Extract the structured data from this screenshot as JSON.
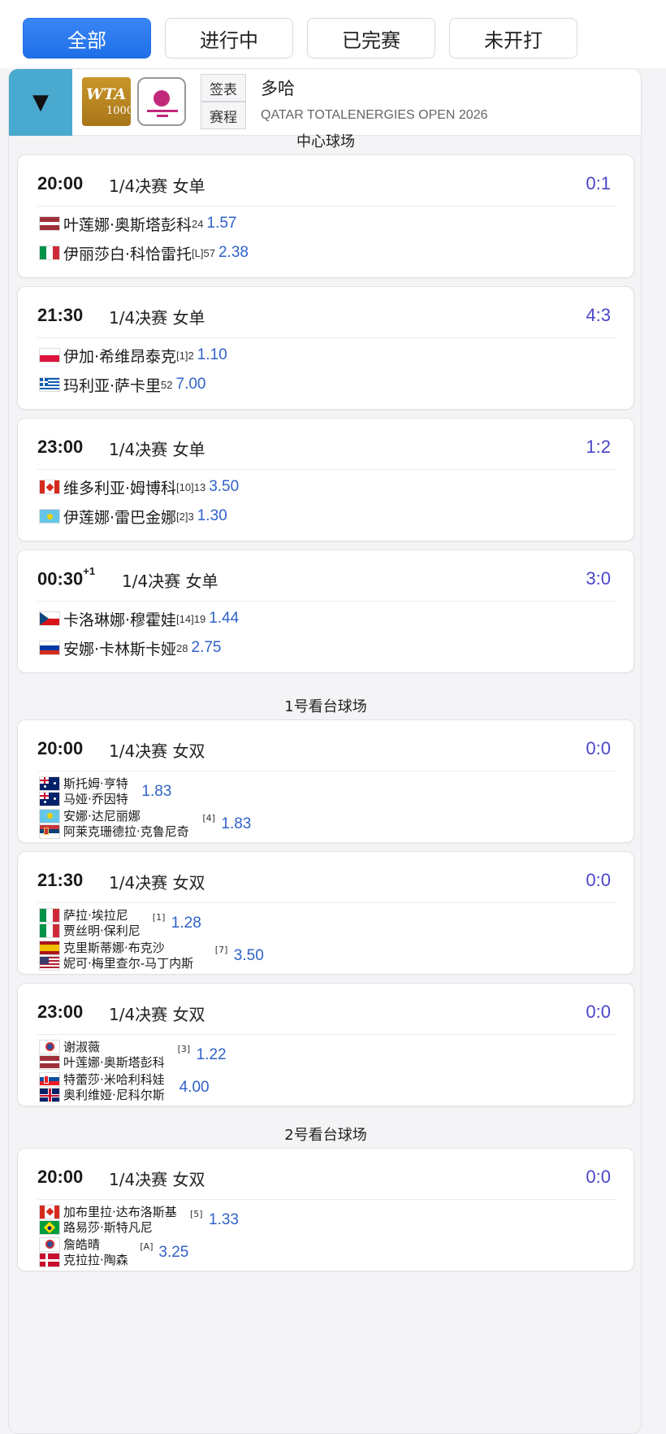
{
  "tabs": [
    {
      "label": "全部",
      "active": true
    },
    {
      "label": "进行中",
      "active": false
    },
    {
      "label": "已完赛",
      "active": false
    },
    {
      "label": "未开打",
      "active": false
    }
  ],
  "header": {
    "toggle_icon": "▼",
    "logo_wta_text": "WTA",
    "logo_wta_sub": "1000",
    "btn_draw": "签表",
    "btn_schedule": "赛程",
    "city": "多哈",
    "event_name": "QATAR TOTALENERGIES OPEN 2026"
  },
  "courts": [
    {
      "name": "中心球场",
      "matches": [
        {
          "time": "20:00",
          "time_sup": "",
          "round": "1/4决赛 女单",
          "score": "0:1",
          "players": [
            {
              "flag": "latvia",
              "name": "叶莲娜·奥斯塔彭科",
              "seed": "24",
              "odds": "1.57"
            },
            {
              "flag": "italy",
              "name": "伊丽莎白·科恰雷托",
              "seed": "[L]57",
              "odds": "2.38"
            }
          ]
        },
        {
          "time": "21:30",
          "time_sup": "",
          "round": "1/4决赛 女单",
          "score": "4:3",
          "players": [
            {
              "flag": "poland",
              "name": "伊加·希维昂泰克",
              "seed": "[1]2",
              "odds": "1.10"
            },
            {
              "flag": "greece",
              "name": "玛利亚·萨卡里",
              "seed": "52",
              "odds": "7.00"
            }
          ]
        },
        {
          "time": "23:00",
          "time_sup": "",
          "round": "1/4决赛 女单",
          "score": "1:2",
          "players": [
            {
              "flag": "canada",
              "name": "维多利亚·姆博科",
              "seed": "[10]13",
              "odds": "3.50"
            },
            {
              "flag": "kazakhstan",
              "name": "伊莲娜·雷巴金娜",
              "seed": "[2]3",
              "odds": "1.30"
            }
          ]
        },
        {
          "time": "00:30",
          "time_sup": "+1",
          "round": "1/4决赛 女单",
          "score": "3:0",
          "players": [
            {
              "flag": "czech",
              "name": "卡洛琳娜·穆霍娃",
              "seed": "[14]19",
              "odds": "1.44"
            },
            {
              "flag": "russia",
              "name": "安娜·卡林斯卡娅",
              "seed": "28",
              "odds": "2.75"
            }
          ]
        }
      ]
    },
    {
      "name": "1号看台球场",
      "matches": [
        {
          "time": "20:00",
          "time_sup": "",
          "round": "1/4决赛 女双",
          "score": "0:0",
          "teams": [
            {
              "players": [
                {
                  "flag": "australia",
                  "name": "斯托姆·亨特"
                },
                {
                  "flag": "australia",
                  "name": "马娅·乔因特"
                }
              ],
              "seed": "",
              "odds": "1.83"
            },
            {
              "players": [
                {
                  "flag": "kazakhstan",
                  "name": "安娜·达尼丽娜"
                },
                {
                  "flag": "serbia",
                  "name": "阿莱克珊德拉·克鲁尼奇"
                }
              ],
              "seed": "[4]",
              "odds": "1.83"
            }
          ]
        },
        {
          "time": "21:30",
          "time_sup": "",
          "round": "1/4决赛 女双",
          "score": "0:0",
          "teams": [
            {
              "players": [
                {
                  "flag": "italy",
                  "name": "萨拉·埃拉尼"
                },
                {
                  "flag": "italy",
                  "name": "贾丝明·保利尼"
                }
              ],
              "seed": "[1]",
              "odds": "1.28"
            },
            {
              "players": [
                {
                  "flag": "spain",
                  "name": "克里斯蒂娜·布克沙"
                },
                {
                  "flag": "usa",
                  "name": "妮可·梅里查尔-马丁内斯"
                }
              ],
              "seed": "[7]",
              "odds": "3.50"
            }
          ]
        },
        {
          "time": "23:00",
          "time_sup": "",
          "round": "1/4决赛 女双",
          "score": "0:0",
          "teams": [
            {
              "players": [
                {
                  "flag": "taipei",
                  "name": "谢淑薇"
                },
                {
                  "flag": "latvia",
                  "name": "叶莲娜·奥斯塔彭科"
                }
              ],
              "seed": "[3]",
              "odds": "1.22"
            },
            {
              "players": [
                {
                  "flag": "slovakia",
                  "name": "特蕾莎·米哈利科娃"
                },
                {
                  "flag": "uk",
                  "name": "奥利维娅·尼科尔斯"
                }
              ],
              "seed": "",
              "odds": "4.00"
            }
          ]
        }
      ]
    },
    {
      "name": "2号看台球场",
      "matches": [
        {
          "time": "20:00",
          "time_sup": "",
          "round": "1/4决赛 女双",
          "score": "0:0",
          "teams": [
            {
              "players": [
                {
                  "flag": "canada",
                  "name": "加布里拉·达布洛斯基"
                },
                {
                  "flag": "brazil",
                  "name": "路易莎·斯特凡尼"
                }
              ],
              "seed": "[5]",
              "odds": "1.33"
            },
            {
              "players": [
                {
                  "flag": "taipei",
                  "name": "詹皓晴"
                },
                {
                  "flag": "denmark",
                  "name": "克拉拉·陶森"
                }
              ],
              "seed": "[A]",
              "odds": "3.25"
            }
          ]
        }
      ]
    }
  ]
}
